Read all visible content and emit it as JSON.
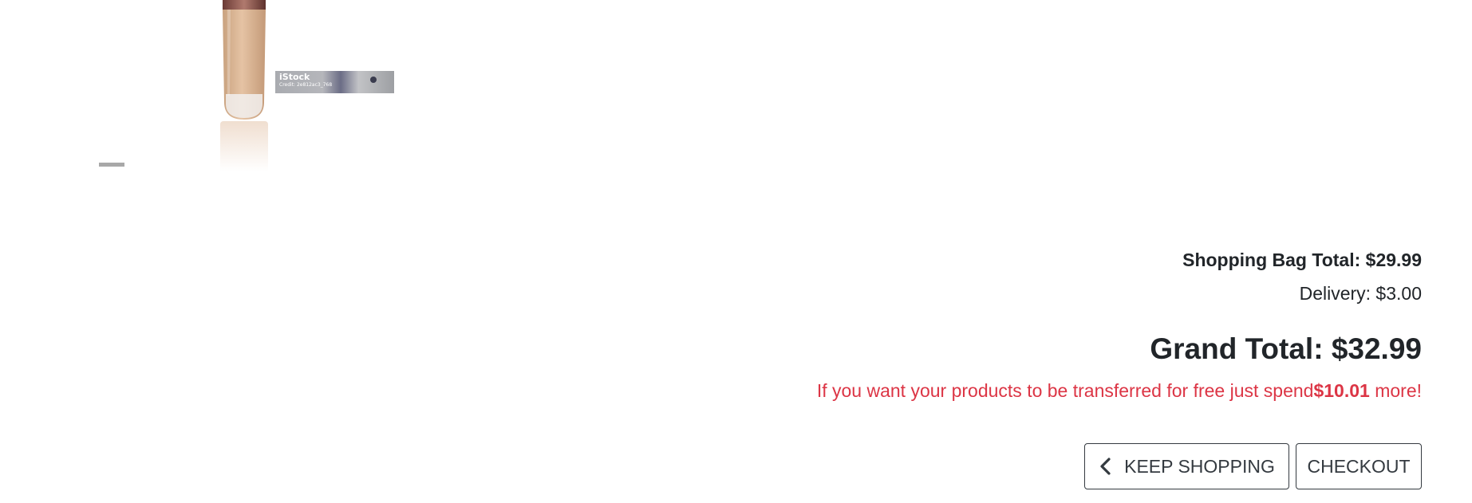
{
  "product": {
    "image_icon": "foundation-bottle-image",
    "watermark": {
      "brand": "iStock",
      "credit": "Credit: 2e812ac3_768"
    }
  },
  "summary": {
    "bag_total": "Shopping Bag Total: $29.99",
    "delivery": "Delivery: $3.00",
    "grand_total": "Grand Total: $32.99",
    "free_shipping_prefix": "If you want your products to be transferred for free just spend",
    "free_shipping_amount": "$10.01",
    "free_shipping_suffix": " more!"
  },
  "actions": {
    "keep_shopping_label": "KEEP SHOPPING",
    "keep_shopping_icon": "chevron-left-icon",
    "checkout_label": "CHECKOUT"
  },
  "colors": {
    "text": "#212529",
    "warning": "#dc3545",
    "button_border": "#343a40"
  }
}
